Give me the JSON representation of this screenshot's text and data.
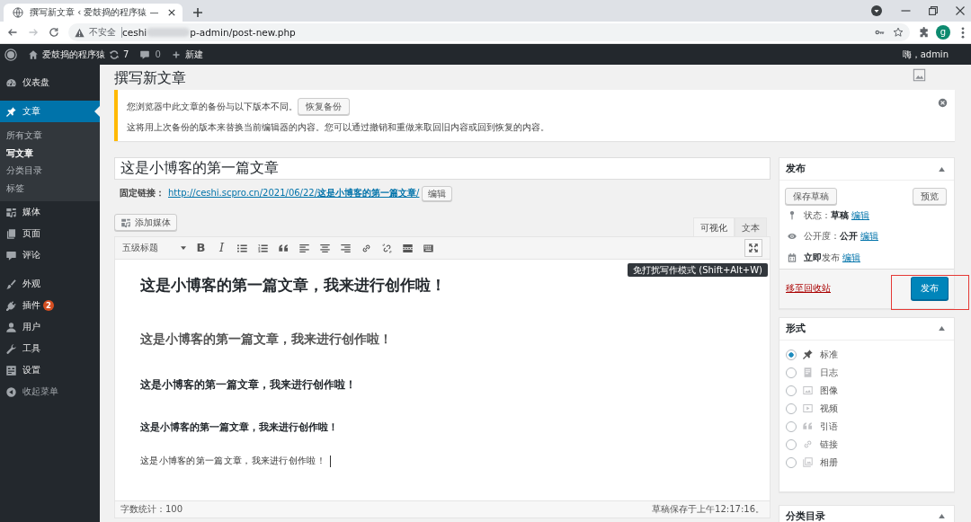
{
  "browser": {
    "tab_title": "撰写新文章 ‹ 爱鼓捣的程序猿 —",
    "security_label": "不安全",
    "url_start": "ceshi",
    "url_end": "p-admin/post-new.php",
    "profile_initial": "g"
  },
  "admin_bar": {
    "site_name": "爱鼓捣的程序猿",
    "updates": "7",
    "comments": "0",
    "new_label": "新建",
    "greeting": "嗨，admin"
  },
  "sidebar": {
    "sections": [
      [
        {
          "kind": "dashboard",
          "label": "仪表盘",
          "selected": false
        }
      ],
      [
        {
          "kind": "posts",
          "label": "文章",
          "selected": true,
          "children": [
            {
              "label": "所有文章",
              "selected": false
            },
            {
              "label": "写文章",
              "selected": true
            },
            {
              "label": "分类目录",
              "selected": false
            },
            {
              "label": "标签",
              "selected": false
            }
          ]
        },
        {
          "kind": "media",
          "label": "媒体",
          "selected": false
        },
        {
          "kind": "pages",
          "label": "页面",
          "selected": false
        },
        {
          "kind": "comments",
          "label": "评论",
          "selected": false
        }
      ],
      [
        {
          "kind": "appearance",
          "label": "外观",
          "selected": false
        },
        {
          "kind": "plugins",
          "label": "插件",
          "selected": false,
          "badge": "2"
        },
        {
          "kind": "users",
          "label": "用户",
          "selected": false
        },
        {
          "kind": "tools",
          "label": "工具",
          "selected": false
        },
        {
          "kind": "settings",
          "label": "设置",
          "selected": false
        },
        {
          "kind": "collapse",
          "label": "收起菜单",
          "selected": false
        }
      ]
    ]
  },
  "page": {
    "title": "撰写新文章"
  },
  "notice": {
    "message": "您浏览器中此文章的备份与以下版本不同。",
    "button": "恢复备份",
    "detail": "这将用上次备份的版本来替换当前编辑器的内容。您可以通过撤销和重做来取回旧内容或回到恢复的内容。"
  },
  "post": {
    "title": "这是小博客的第一篇文章",
    "permalink_label": "固定链接：",
    "permalink": "http://ceshi.scpro.cn/2021/06/22/**这是小博客的第一篇文章**/",
    "permalink_button": "编辑"
  },
  "editor": {
    "add_media": "添加媒体",
    "tabs": [
      {
        "label": "可视化",
        "selected": true
      },
      {
        "label": "文本",
        "selected": false
      }
    ],
    "format": "五级标题",
    "toolbar": [
      {
        "kind": "bold",
        "glyph": "B"
      },
      {
        "kind": "italic",
        "glyph": "I"
      },
      {
        "kind": "bullet-list"
      },
      {
        "kind": "numbered-list"
      },
      {
        "kind": "blockquote"
      },
      {
        "kind": "align-left"
      },
      {
        "kind": "align-center"
      },
      {
        "kind": "align-right"
      },
      {
        "kind": "link"
      },
      {
        "kind": "unlink"
      },
      {
        "kind": "read-more"
      },
      {
        "kind": "toolbar-toggle"
      }
    ],
    "fullscreen_tooltip": "免打扰写作模式 (Shift+Alt+W)",
    "blocks": [
      {
        "kind": "h1",
        "text": "这是小博客的第一篇文章，我来进行创作啦！",
        "caret": false
      },
      {
        "kind": "h2",
        "text": "这是小博客的第一篇文章，我来进行创作啦！",
        "caret": false
      },
      {
        "kind": "h3",
        "text": "这是小博客的第一篇文章，我来进行创作啦！",
        "caret": false
      },
      {
        "kind": "h4",
        "text": "这是小博客的第一篇文章，我来进行创作啦！",
        "caret": false
      },
      {
        "kind": "p",
        "text": "这是小博客的第一篇文章，我来进行创作啦！",
        "caret": true
      }
    ],
    "word_count": "字数统计：100",
    "autosave": "草稿保存于上午12:17:16。"
  },
  "publish": {
    "title": "发布",
    "expanded": true,
    "save_draft": "保存草稿",
    "preview": "预览",
    "meta": [
      {
        "kind": "status",
        "text": "状态：**草稿**",
        "link": "编辑"
      },
      {
        "kind": "visibility",
        "text": "公开度：**公开**",
        "link": "编辑"
      },
      {
        "kind": "schedule",
        "text": "**立即**发布",
        "link": "编辑"
      }
    ],
    "trash": "移至回收站",
    "publish_button": "发布",
    "highlighted": true
  },
  "format_box": {
    "title": "形式",
    "expanded": true,
    "options": [
      {
        "kind": "standard",
        "label": "标准",
        "selected": true
      },
      {
        "kind": "aside",
        "label": "日志",
        "selected": false
      },
      {
        "kind": "image",
        "label": "图像",
        "selected": false
      },
      {
        "kind": "video",
        "label": "视频",
        "selected": false
      },
      {
        "kind": "quote",
        "label": "引语",
        "selected": false
      },
      {
        "kind": "link",
        "label": "链接",
        "selected": false
      },
      {
        "kind": "gallery",
        "label": "相册",
        "selected": false
      }
    ]
  },
  "categories_box": {
    "title": "分类目录",
    "expanded": true
  }
}
